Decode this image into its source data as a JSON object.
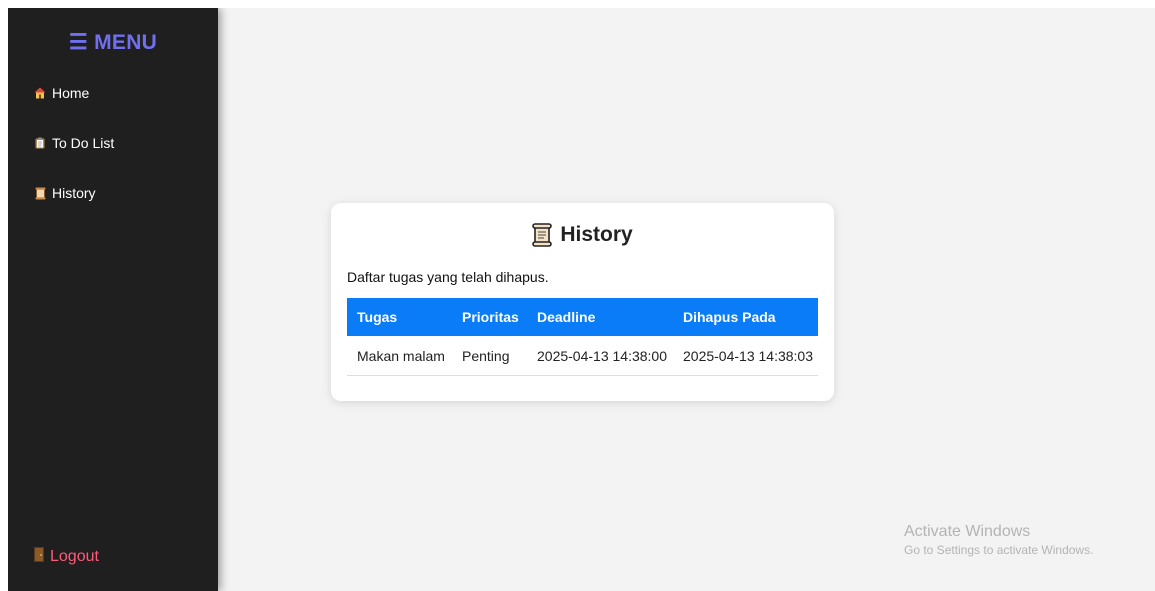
{
  "sidebar": {
    "menu_label": "☰ MENU",
    "items": [
      {
        "icon": "house-icon",
        "label": "Home"
      },
      {
        "icon": "clipboard-icon",
        "label": "To Do List"
      },
      {
        "icon": "scroll-icon",
        "label": "History"
      }
    ],
    "logout_label": "Logout",
    "logout_icon": "door-icon"
  },
  "card": {
    "icon": "scroll-icon",
    "title": "History",
    "description": "Daftar tugas yang telah dihapus.",
    "headers": [
      "Tugas",
      "Prioritas",
      "Deadline",
      "Dihapus Pada"
    ],
    "rows": [
      [
        "Makan malam",
        "Penting",
        "2025-04-13 14:38:00",
        "2025-04-13 14:38:03"
      ]
    ]
  },
  "watermark": {
    "title": "Activate Windows",
    "subtitle": "Go to Settings to activate Windows."
  },
  "colors": {
    "sidebar_bg": "#1f1f1f",
    "menu_accent": "#6f6ff0",
    "table_header": "#0a7cf7",
    "logout": "#ff5a7a",
    "page_bg": "#f3f3f3"
  }
}
